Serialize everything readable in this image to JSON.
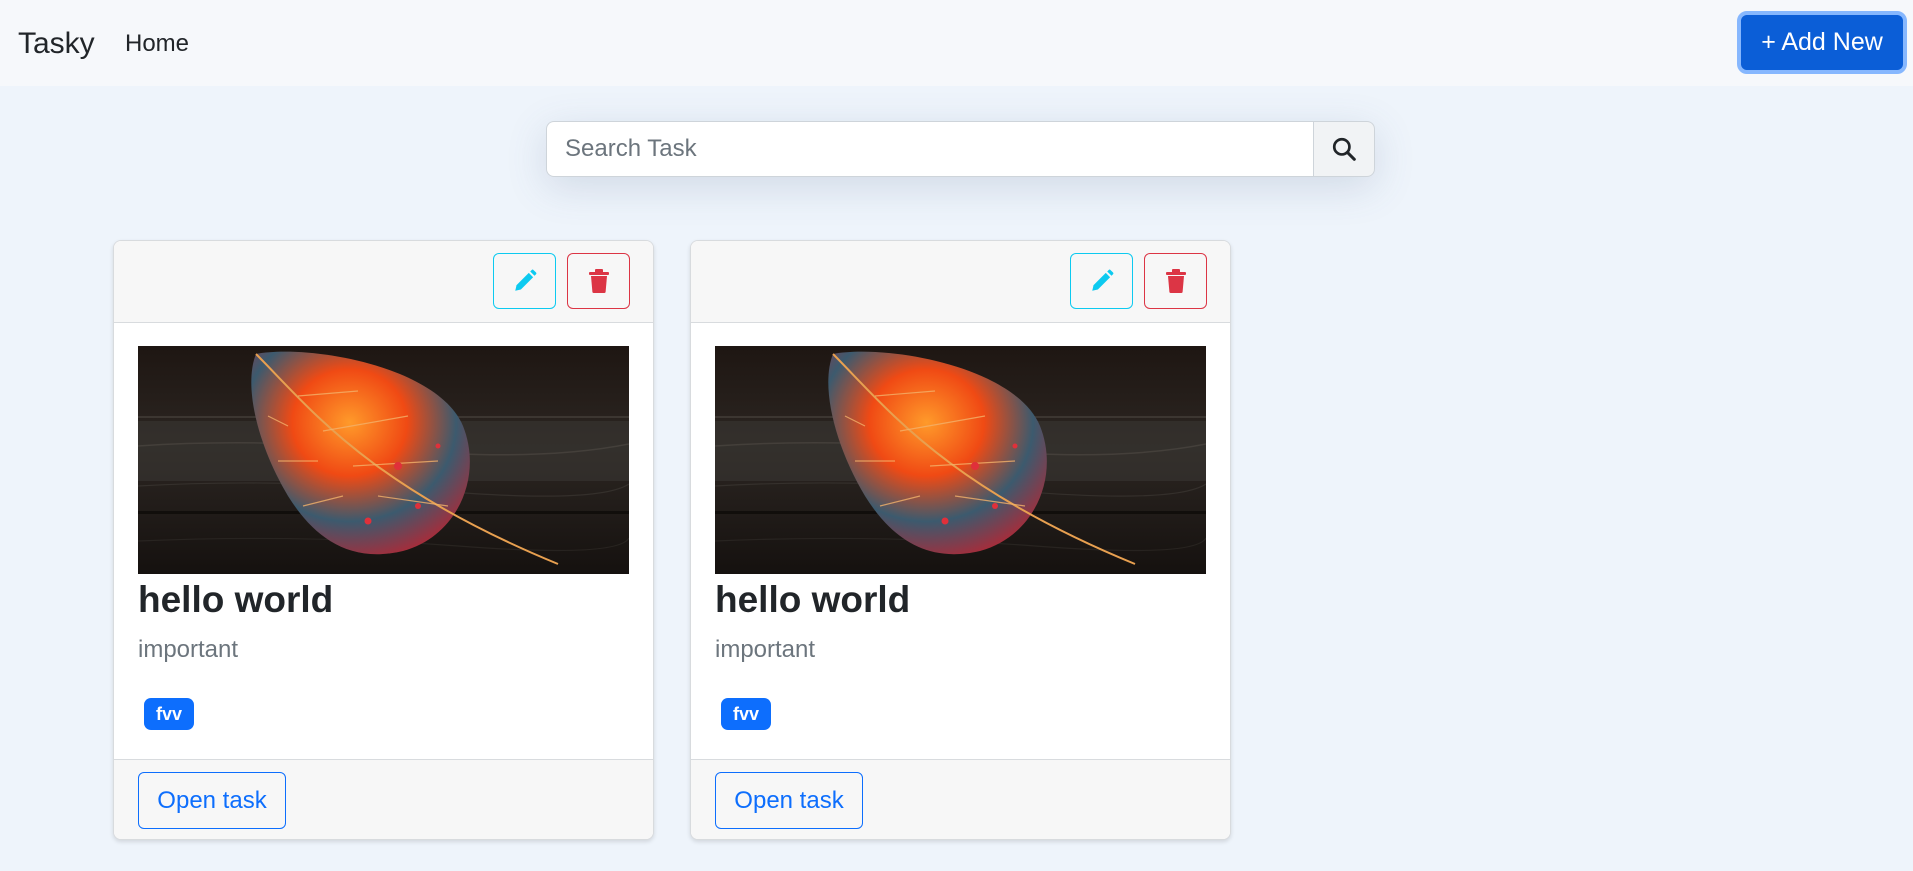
{
  "navbar": {
    "brand": "Tasky",
    "home_label": "Home",
    "add_new_label": "+ Add New"
  },
  "search": {
    "placeholder": "Search Task",
    "value": "",
    "button_icon": "search-icon"
  },
  "colors": {
    "primary": "#0d6efd",
    "info": "#0dcaf0",
    "danger": "#dc3545",
    "muted": "#6c757d",
    "page_bg": "#eef4fb"
  },
  "cards": [
    {
      "edit_icon": "pencil-icon",
      "delete_icon": "trash-icon",
      "image": "autumn-leaf-on-wood",
      "title": "hello world",
      "description": "important",
      "tag": "fvv",
      "open_label": "Open task"
    },
    {
      "edit_icon": "pencil-icon",
      "delete_icon": "trash-icon",
      "image": "autumn-leaf-on-wood",
      "title": "hello world",
      "description": "important",
      "tag": "fvv",
      "open_label": "Open task"
    }
  ]
}
